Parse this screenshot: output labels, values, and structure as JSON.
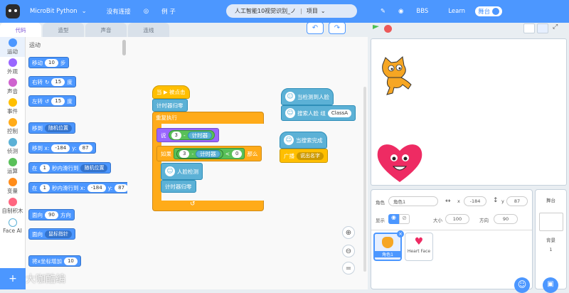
{
  "topbar": {
    "app": "MicroBit Python",
    "connection": "没有连接",
    "examples": "例 子",
    "project_name": "人工智能10视觉识别_ノ",
    "project_menu": "项目",
    "bbs": "BBS",
    "learn": "Learn",
    "toggle": "舞台"
  },
  "tabs": [
    "代码",
    "造型",
    "声音",
    "连线"
  ],
  "categories": [
    {
      "label": "运动",
      "color": "#4c97ff"
    },
    {
      "label": "外观",
      "color": "#9966ff"
    },
    {
      "label": "声音",
      "color": "#cf63cf"
    },
    {
      "label": "事件",
      "color": "#ffbf00"
    },
    {
      "label": "控制",
      "color": "#ffab19"
    },
    {
      "label": "侦测",
      "color": "#5cb1d6"
    },
    {
      "label": "运算",
      "color": "#59c059"
    },
    {
      "label": "变量",
      "color": "#ff8c1a"
    },
    {
      "label": "自制积木",
      "color": "#ff6680"
    },
    {
      "label": "Face AI",
      "color": "#5cb1d6"
    }
  ],
  "palette": {
    "title": "运动",
    "move": {
      "t1": "移动",
      "v": "10",
      "t2": "步"
    },
    "turn_right": {
      "t1": "右转",
      "v": "15",
      "t2": "度"
    },
    "turn_left": {
      "t1": "左转",
      "v": "15",
      "t2": "度"
    },
    "goto": {
      "t1": "移到",
      "dd": "随机位置"
    },
    "goto_xy": {
      "t1": "移到 x:",
      "x": "-184",
      "t2": "y:",
      "y": "87"
    },
    "glide": {
      "t1": "在",
      "v": "1",
      "t2": "秒内滑行到",
      "dd": "随机位置"
    },
    "glide_xy": {
      "t1": "在",
      "v": "1",
      "t2": "秒内滑行到 x:",
      "x": "-184",
      "t3": "y:",
      "y": "87"
    },
    "point": {
      "t1": "面向",
      "v": "90",
      "t2": "方向"
    },
    "point_towards": {
      "t1": "面向",
      "dd": "鼠标指针"
    },
    "change_x": {
      "t1": "将x坐标增加",
      "v": "10"
    },
    "watermark": "大咖酷编"
  },
  "script1": {
    "hat": "当 ▶ 被点击",
    "reset": "计时器归零",
    "forever": "重复执行",
    "say": {
      "t": "说",
      "a": "3",
      "op": "-",
      "b": "计时器"
    },
    "if": {
      "t": "如果",
      "a": "3",
      "op": "-",
      "b": "计时器",
      "cmp": "<",
      "c": "0",
      "then": "那么"
    },
    "face": "人脸检测",
    "reset2": "计时器归零"
  },
  "script2": {
    "hat": "当检测到人脸",
    "search": "搜索人脸 组",
    "group": "ClassA"
  },
  "script3": {
    "hat": "当搜索完成",
    "broadcast": "广播",
    "msg": "说出名字"
  },
  "sprite_info": {
    "label": "角色",
    "name": "角色1",
    "x": "-184",
    "y": "87",
    "show": "显示",
    "size_label": "大小",
    "size": "100",
    "dir_label": "方向",
    "dir": "90"
  },
  "sprites": [
    {
      "name": "角色1"
    },
    {
      "name": "Heart Face"
    }
  ],
  "stage_panel": {
    "title": "舞台",
    "backdrop_label": "背景",
    "backdrop_count": "1"
  },
  "colors": {
    "brand": "#4c97ff",
    "events": "#ffbf00",
    "control": "#ffab19",
    "face": "#5cb1d6",
    "operators": "#59c059"
  }
}
